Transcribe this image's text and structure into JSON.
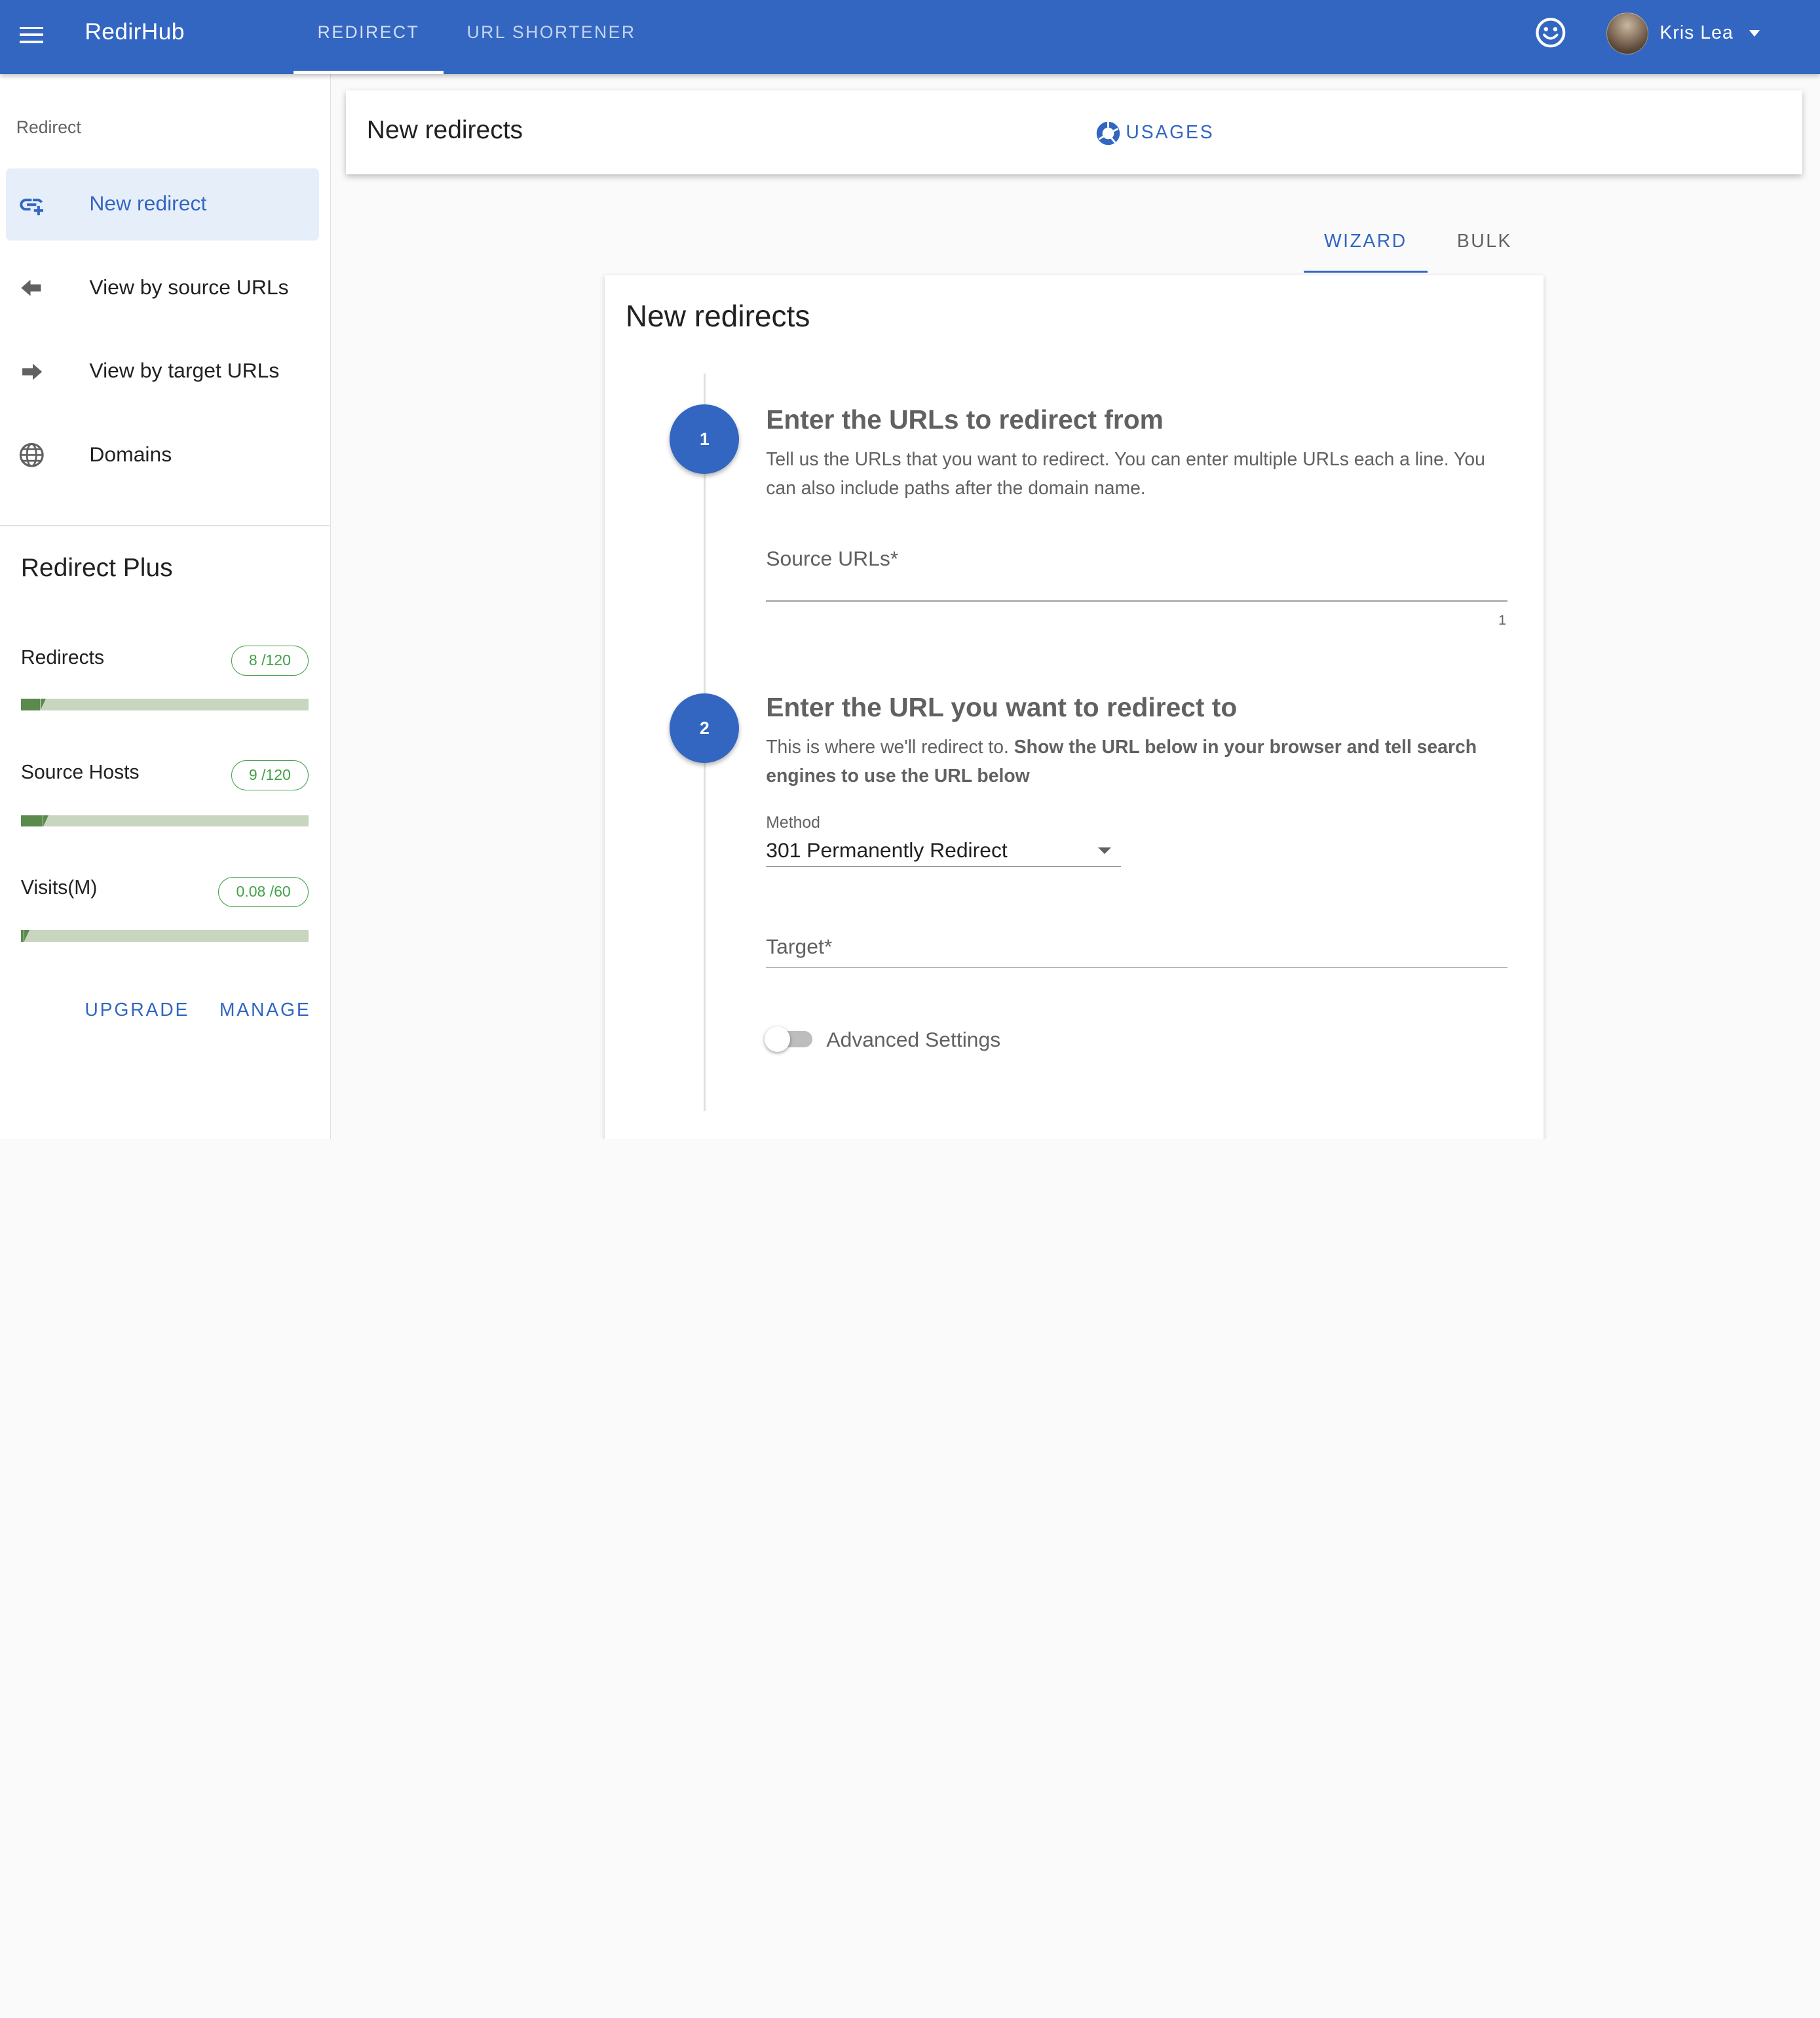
{
  "app": {
    "brand": "RedirHub",
    "nav_tabs": [
      "REDIRECT",
      "URL SHORTENER"
    ],
    "user_name": "Kris Lea"
  },
  "sidebar": {
    "header": "Redirect",
    "items": [
      {
        "label": "New redirect",
        "icon": "add-link-icon"
      },
      {
        "label": "View by source URLs",
        "icon": "arrow-left-icon"
      },
      {
        "label": "View by target URLs",
        "icon": "arrow-right-icon"
      },
      {
        "label": "Domains",
        "icon": "globe-icon"
      }
    ],
    "plus": {
      "title": "Redirect Plus",
      "metrics": [
        {
          "label": "Redirects",
          "chip": "8 /120",
          "fraction": 0.067
        },
        {
          "label": "Source Hosts",
          "chip": "9 /120",
          "fraction": 0.075
        },
        {
          "label": "Visits(M)",
          "chip": "0.08 /60",
          "fraction": 0.0013
        }
      ],
      "upgrade_label": "UPGRADE",
      "manage_label": "MANAGE"
    }
  },
  "main": {
    "title": "New redirects",
    "usages_label": "USAGES",
    "tabs": [
      "WIZARD",
      "BULK"
    ],
    "card": {
      "title": "New redirects",
      "step1": {
        "number": "1",
        "title": "Enter the URLs to redirect from",
        "desc": "Tell us the URLs that you want to redirect. You can enter multiple URLs each a line. You can also include paths after the domain name.",
        "source_label": "Source URLs*",
        "counter": "1"
      },
      "step2": {
        "number": "2",
        "title": "Enter the URL you want to redirect to",
        "desc_plain": "This is where we'll redirect to.",
        "desc_bold": "Show the URL below in your browser and tell search engines to use the URL below",
        "method_label": "Method",
        "method_value": "301 Permanently Redirect",
        "target_label": "Target*",
        "advanced_label": "Advanced Settings",
        "advanced_enabled": false
      }
    }
  },
  "colors": {
    "primary": "#3266c1",
    "success": "#43a047",
    "progress_fill": "#5a8a4c",
    "progress_track": "#c8d6c0"
  }
}
